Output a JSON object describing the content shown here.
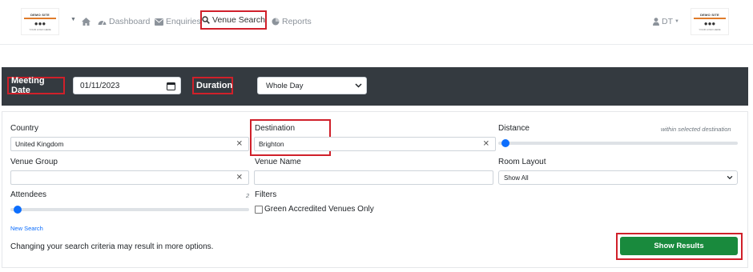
{
  "nav": {
    "logo_left": {
      "title": "DEMO SITE",
      "subtitle": "YOUR LOGO HERE"
    },
    "logo_right": {
      "title": "DEMO SITE",
      "subtitle": "YOUR LOGO HERE"
    },
    "items": [
      {
        "label": "Dashboard",
        "icon": "dashboard-icon"
      },
      {
        "label": "Enquiries",
        "icon": "envelope-icon"
      },
      {
        "label": "Venue Search",
        "icon": "search-icon"
      },
      {
        "label": "Reports",
        "icon": "pie-chart-icon"
      }
    ],
    "user_label": "DT"
  },
  "search_bar": {
    "meeting_date_label": "Meeting Date",
    "meeting_date_value": "01/11/2023",
    "duration_label": "Duration",
    "duration_value": "Whole Day"
  },
  "form": {
    "country_label": "Country",
    "country_value": "United Kingdom",
    "destination_label": "Destination",
    "destination_value": "Brighton",
    "distance_label": "Distance",
    "distance_hint": "within selected destination",
    "venue_group_label": "Venue Group",
    "venue_group_value": "",
    "venue_name_label": "Venue Name",
    "venue_name_value": "",
    "room_layout_label": "Room Layout",
    "room_layout_value": "Show All",
    "attendees_label": "Attendees",
    "attendees_value": "2",
    "filters_label": "Filters",
    "green_accredited_label": "Green Accredited Venues Only",
    "new_search_link": "New Search",
    "criteria_note": "Changing your search criteria may result in more options.",
    "show_results_button": "Show Results"
  },
  "colors": {
    "accent_blue": "#0d6efd",
    "highlight_red": "#d0202a",
    "button_green": "#198a3d",
    "dark_bar": "#343a40"
  }
}
